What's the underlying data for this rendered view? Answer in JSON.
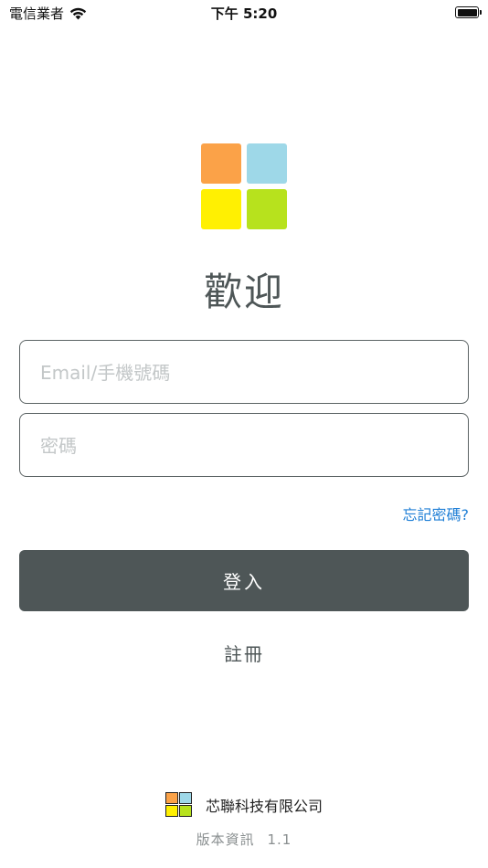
{
  "status_bar": {
    "carrier": "電信業者",
    "time": "下午 5:20"
  },
  "welcome_title": "歡迎",
  "logo_colors": [
    "#fba248",
    "#9ed8e8",
    "#fff002",
    "#b7e21d"
  ],
  "form": {
    "account_placeholder": "Email/手機號碼",
    "password_placeholder": "密碼",
    "forgot_password": "忘記密碼?",
    "login_label": "登入",
    "register_label": "註冊"
  },
  "footer": {
    "company_name": "芯聯科技有限公司",
    "version_label": "版本資訊",
    "version_number": "1.1"
  }
}
